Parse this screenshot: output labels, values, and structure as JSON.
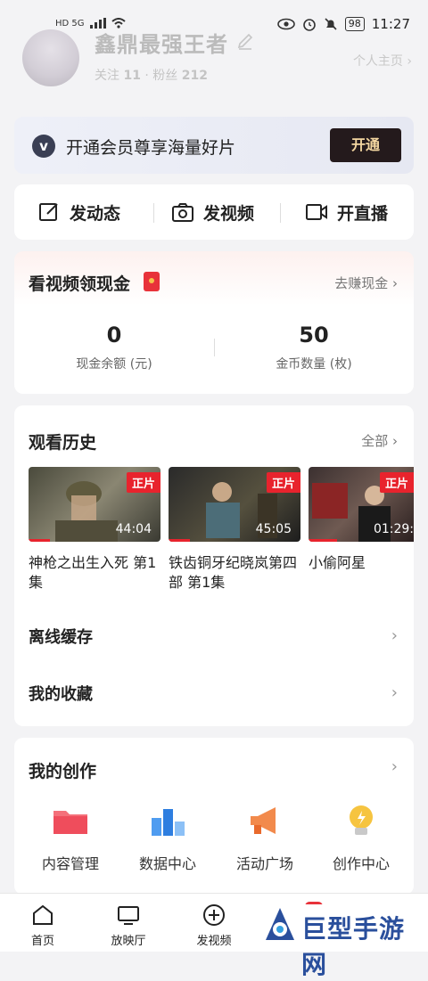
{
  "status": {
    "time": "11:27",
    "battery": "98",
    "left_label": "HD 5G"
  },
  "profile": {
    "username": "鑫鼎最强王者",
    "follow_label": "关注",
    "follow_count": "11",
    "fans_label": "粉丝",
    "fans_count": "212",
    "homepage_link": "个人主页 ›"
  },
  "vip": {
    "logo": "v",
    "text": "开通会员尊享海量好片",
    "button": "开通"
  },
  "actions": [
    {
      "label": "发动态",
      "icon": "edit-icon"
    },
    {
      "label": "发视频",
      "icon": "camera-icon"
    },
    {
      "label": "开直播",
      "icon": "video-camera-icon"
    }
  ],
  "cash": {
    "title": "看视频领现金",
    "earn_link": "去赚现金 ›",
    "stats": [
      {
        "value": "0",
        "label": "现金余额 (元)"
      },
      {
        "value": "50",
        "label": "金币数量 (枚)"
      }
    ]
  },
  "history": {
    "title": "观看历史",
    "all_link": "全部 ›",
    "items": [
      {
        "title": "神枪之出生入死 第1集",
        "tag": "正片",
        "duration": "44:04",
        "progress": 0.16
      },
      {
        "title": "铁齿铜牙纪晓岚第四部 第1集",
        "tag": "正片",
        "duration": "45:05",
        "progress": 0.16
      },
      {
        "title": "小偷阿星",
        "tag": "正片",
        "duration": "01:29:",
        "progress": 0.27
      }
    ]
  },
  "rows": {
    "offline": "离线缓存",
    "favorites": "我的收藏",
    "chevron": "›"
  },
  "creation": {
    "title": "我的创作",
    "tools": [
      {
        "label": "内容管理",
        "icon": "folder-icon"
      },
      {
        "label": "数据中心",
        "icon": "chart-icon"
      },
      {
        "label": "活动广场",
        "icon": "megaphone-icon"
      },
      {
        "label": "创作中心",
        "icon": "lightbulb-icon"
      }
    ]
  },
  "tabbar": [
    {
      "label": "首页",
      "icon": "home-icon"
    },
    {
      "label": "放映厅",
      "icon": "tv-icon"
    },
    {
      "label": "发视频",
      "icon": "plus-circle-icon"
    }
  ],
  "watermark": {
    "text": "巨型手游网"
  }
}
